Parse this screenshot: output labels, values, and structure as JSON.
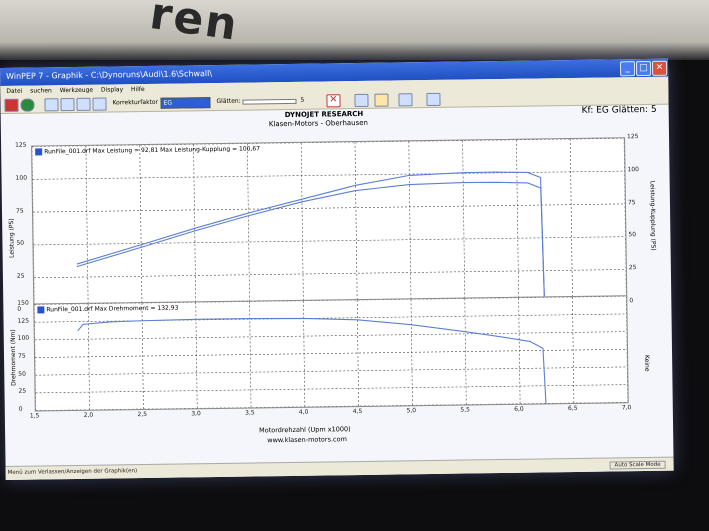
{
  "window": {
    "title": "WinPEP 7 - Graphik - C:\\Dynoruns\\Audi\\1.6\\Schwall\\",
    "minimize": "_",
    "maximize": "□",
    "close": "✕"
  },
  "menu": [
    "Datei",
    "suchen",
    "Werkzeuge",
    "Display",
    "Hilfe"
  ],
  "toolbar": {
    "correction_label": "Korrekturfaktor",
    "correction_value": "EG",
    "smoothing_label": "Glätten:",
    "smoothing_value": "5"
  },
  "header": {
    "company": "DYNOJET RESEARCH",
    "shop": "Klasen-Motors - Oberhausen",
    "kf_summary": "Kf: EG  Glätten: 5"
  },
  "chart_data": [
    {
      "type": "line",
      "panel": "power",
      "legend": "RunFile_001.drf Max Leistung = 92,81 Max Leistung-Kupplung = 100,67",
      "ylabel": "Leistung (PS)",
      "ylabel_right": "Leistung-Kupplung (PS)",
      "ylim": [
        0,
        125
      ],
      "yticks": [
        "0",
        "25",
        "50",
        "75",
        "100",
        "125"
      ],
      "yticks_right": [
        "0",
        "25",
        "50",
        "75",
        "100",
        "125"
      ],
      "series": [
        {
          "name": "Leistung",
          "x": [
            1.9,
            2.5,
            3.0,
            3.5,
            4.0,
            4.5,
            5.0,
            5.5,
            5.8,
            6.1,
            6.22,
            6.24
          ],
          "y": [
            33,
            47,
            59,
            70,
            80,
            88,
            92,
            93,
            92.8,
            92,
            88,
            0
          ]
        },
        {
          "name": "Leistung-Kupplung",
          "x": [
            1.9,
            2.5,
            3.0,
            3.5,
            4.0,
            4.5,
            5.0,
            5.5,
            5.8,
            6.1,
            6.22,
            6.24
          ],
          "y": [
            35,
            49,
            61,
            72,
            82,
            92,
            99,
            100.5,
            100.6,
            100,
            96,
            0
          ]
        }
      ]
    },
    {
      "type": "line",
      "panel": "torque",
      "legend": "RunFile_001.drf Max Drehmoment = 132,93",
      "ylabel": "Drehmoment (Nm)",
      "ylabel_right": "Keine",
      "ylim": [
        0,
        150
      ],
      "yticks": [
        "0",
        "25",
        "50",
        "75",
        "100",
        "125",
        "150"
      ],
      "xlabel": "Motordrehzahl (Upm x1000)",
      "xticks": [
        "1,5",
        "2,0",
        "2,5",
        "3,0",
        "3,5",
        "4,0",
        "4,5",
        "5,0",
        "5,5",
        "6,0",
        "6,5",
        "7,0"
      ],
      "xlim": [
        1.5,
        7.0
      ],
      "series": [
        {
          "name": "Drehmoment",
          "x": [
            1.9,
            1.95,
            2.2,
            2.5,
            3.0,
            3.5,
            4.0,
            4.5,
            5.0,
            5.5,
            5.8,
            6.1,
            6.22,
            6.24
          ],
          "y": [
            112,
            121,
            124,
            125,
            126,
            126,
            125,
            122,
            114,
            103,
            96,
            88,
            78,
            0
          ]
        }
      ]
    }
  ],
  "footer": {
    "website": "www.klasen-motors.com"
  },
  "status": {
    "left": "Menü zum Verlassen/Anzeigen der Graphik(en)",
    "right": "Auto Scale Mode"
  },
  "colors": {
    "titlebar": "#2454cc",
    "curve": "#5b7fd6",
    "grid": "#444444"
  }
}
